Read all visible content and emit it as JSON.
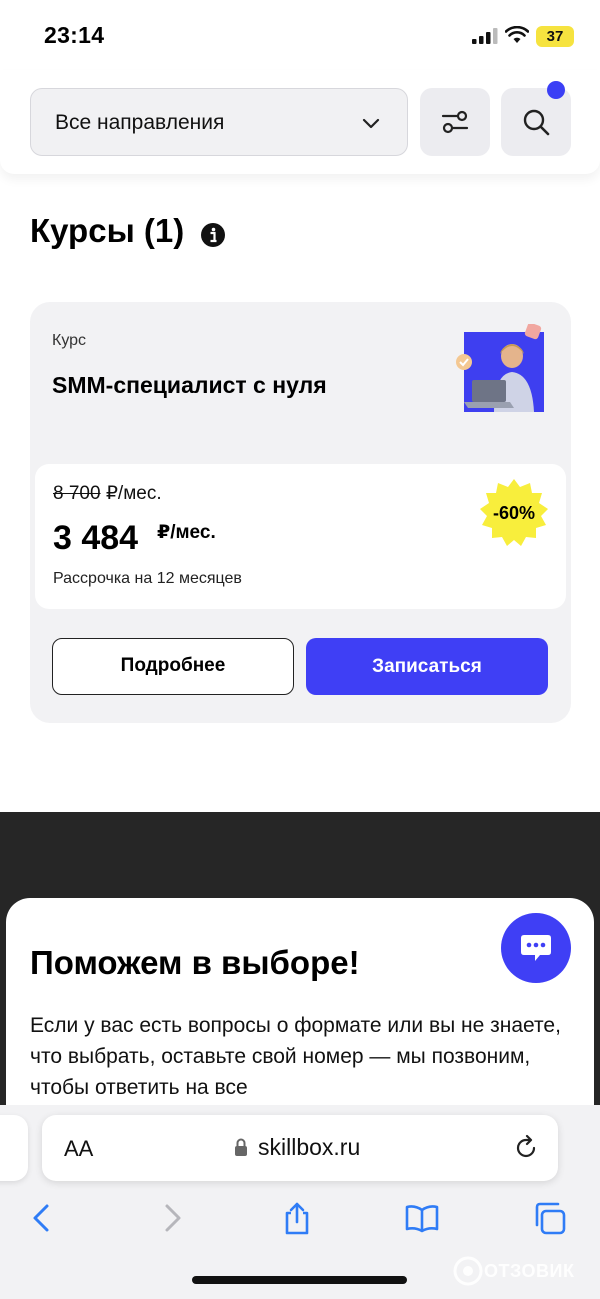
{
  "status_bar": {
    "time": "23:14",
    "battery": "37"
  },
  "filter": {
    "direction_label": "Все направления"
  },
  "section": {
    "title": "Курсы (1)"
  },
  "course": {
    "type": "Курс",
    "name": "SMM-специалист с нуля",
    "old_price": "8 700",
    "old_price_unit": " ₽/мес.",
    "new_price": "3 484",
    "new_price_unit": "₽/мес.",
    "installment": "Рассрочка на 12 месяцев",
    "discount": "-60%",
    "details_label": "Подробнее",
    "enroll_label": "Записаться"
  },
  "help": {
    "title": "Поможем в выборе!",
    "text": "Если у вас есть вопросы о формате или вы не знаете, что выбрать, оставьте свой номер — мы позвоним, чтобы ответить на все"
  },
  "browser": {
    "aa": "AA",
    "url": "skillbox.ru"
  },
  "watermark": "ОТЗОВИК",
  "colors": {
    "accent": "#3f3ff5",
    "badge": "#f8ee3c",
    "dark_section": "#262626"
  },
  "icons": [
    "chevron-down-icon",
    "filter-icon",
    "search-icon",
    "info-icon",
    "chat-icon",
    "lock-icon",
    "reload-icon",
    "back-icon",
    "forward-icon",
    "share-icon",
    "bookmarks-icon",
    "tabs-icon"
  ]
}
